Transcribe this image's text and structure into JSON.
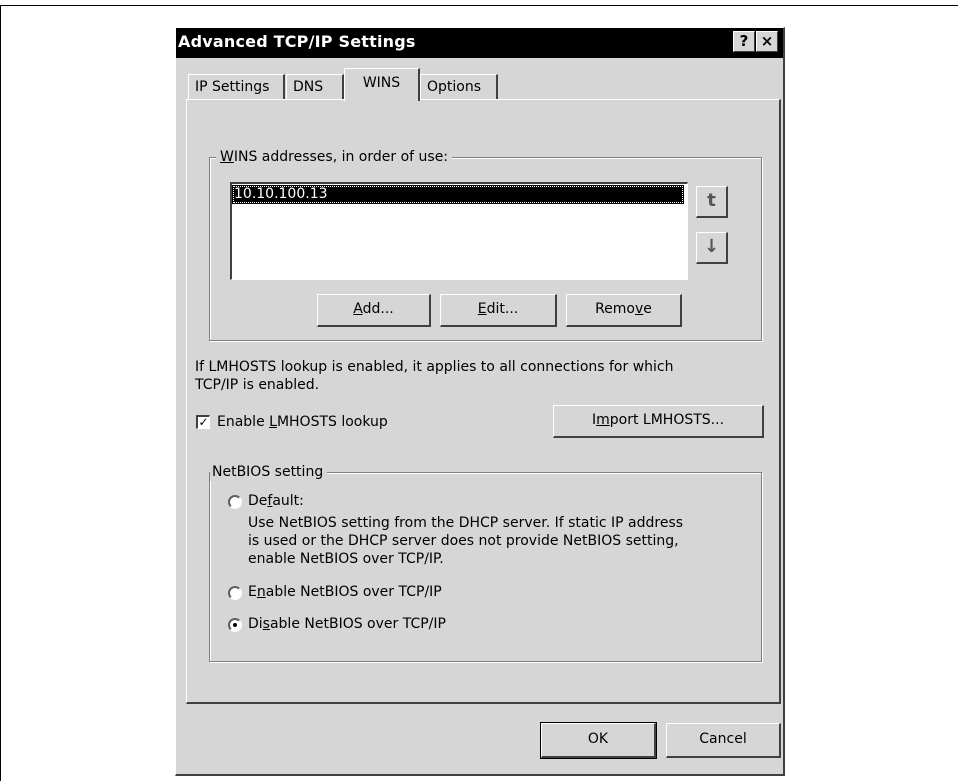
{
  "dialog": {
    "title": "Advanced TCP/IP Settings",
    "help_label": "?",
    "close_label": "×"
  },
  "tabs": [
    {
      "label": "IP Settings"
    },
    {
      "label": "DNS"
    },
    {
      "label": "WINS",
      "active": true
    },
    {
      "label": "Options"
    }
  ],
  "wins": {
    "group_label_pre": "",
    "group_label_key": "W",
    "group_label_post": "INS addresses, in order of use:",
    "addresses": [
      "10.10.100.13"
    ],
    "up_icon": "t",
    "down_icon": "↓",
    "add": {
      "pre": "",
      "key": "A",
      "post": "dd..."
    },
    "edit": {
      "pre": "",
      "key": "E",
      "post": "dit..."
    },
    "remove": {
      "pre": "Remo",
      "key": "v",
      "post": "e"
    }
  },
  "lmhosts": {
    "info_line1": "If LMHOSTS lookup is enabled, it applies to all connections for which",
    "info_line2": "TCP/IP is enabled.",
    "check_mark": "✓",
    "checkbox_label": {
      "pre": "Enable ",
      "key": "L",
      "post": "MHOSTS lookup"
    },
    "checked": true,
    "import": {
      "pre": "I",
      "key": "m",
      "post": "port LMHOSTS..."
    }
  },
  "netbios": {
    "group_label": "NetBIOS setting",
    "default_label": {
      "pre": "De",
      "key": "f",
      "post": "ault:"
    },
    "default_desc": [
      "Use NetBIOS setting from the DHCP server. If static IP address",
      "is used or the DHCP server does not provide NetBIOS setting,",
      "enable NetBIOS over TCP/IP."
    ],
    "enable_label": {
      "pre": "E",
      "key": "n",
      "post": "able NetBIOS over TCP/IP"
    },
    "disable_label": {
      "pre": "Di",
      "key": "s",
      "post": "able NetBIOS over TCP/IP"
    },
    "selected": "disable"
  },
  "footer": {
    "ok": "OK",
    "cancel": "Cancel"
  }
}
